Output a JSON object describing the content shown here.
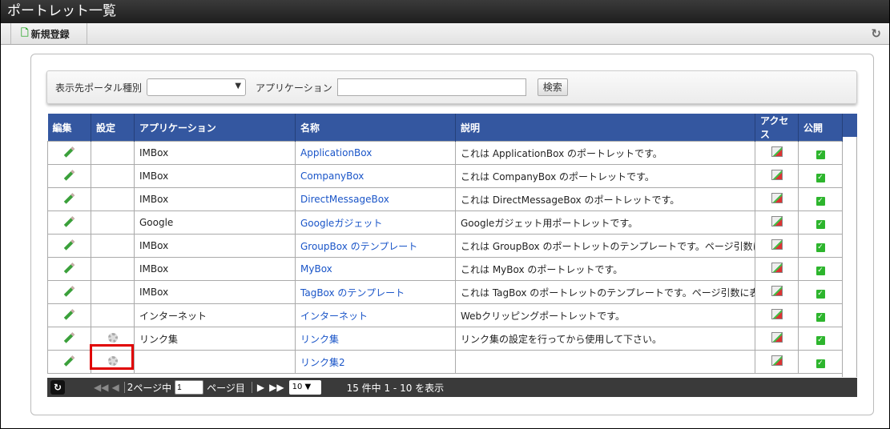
{
  "title": "ポートレット一覧",
  "toolbar": {
    "new_label": "新規登録"
  },
  "search": {
    "portal_type_label": "表示先ポータル種別",
    "portal_type_value": "",
    "app_label": "アプリケーション",
    "app_value": "",
    "search_button": "検索"
  },
  "table": {
    "headers": [
      "編集",
      "設定",
      "アプリケーション",
      "名称",
      "説明",
      "アクセス",
      "公開"
    ],
    "rows": [
      {
        "app": "IMBox",
        "name": "ApplicationBox",
        "desc": "これは ApplicationBox のポートレットです。",
        "settings": false
      },
      {
        "app": "IMBox",
        "name": "CompanyBox",
        "desc": "これは CompanyBox のポートレットです。",
        "settings": false
      },
      {
        "app": "IMBox",
        "name": "DirectMessageBox",
        "desc": "これは DirectMessageBox のポートレットです。",
        "settings": false
      },
      {
        "app": "Google",
        "name": "Googleガジェット",
        "desc": "Googleガジェット用ポートレットです。",
        "settings": false
      },
      {
        "app": "IMBox",
        "name": "GroupBox のテンプレート",
        "desc": "これは GroupBox のポートレットのテンプレートです。ページ引数に表示し",
        "settings": false
      },
      {
        "app": "IMBox",
        "name": "MyBox",
        "desc": "これは MyBox のポートレットです。",
        "settings": false
      },
      {
        "app": "IMBox",
        "name": "TagBox のテンプレート",
        "desc": "これは TagBox のポートレットのテンプレートです。ページ引数に表示した",
        "settings": false
      },
      {
        "app": "インターネット",
        "name": "インターネット",
        "desc": "Webクリッピングポートレットです。",
        "settings": false
      },
      {
        "app": "リンク集",
        "name": "リンク集",
        "desc": "リンク集の設定を行ってから使用して下さい。",
        "settings": true
      },
      {
        "app": "",
        "name": "リンク集2",
        "desc": "",
        "settings": true
      }
    ]
  },
  "pager": {
    "total_pages": "2",
    "page_of_label": "ページ中",
    "current_page": "1",
    "page_label": "ページ目",
    "per_page": "10",
    "summary": "15 件中 1 - 10 を表示"
  },
  "colors": {
    "header": "#3457a0",
    "link": "#1a55c8",
    "highlight": "#e00000"
  }
}
